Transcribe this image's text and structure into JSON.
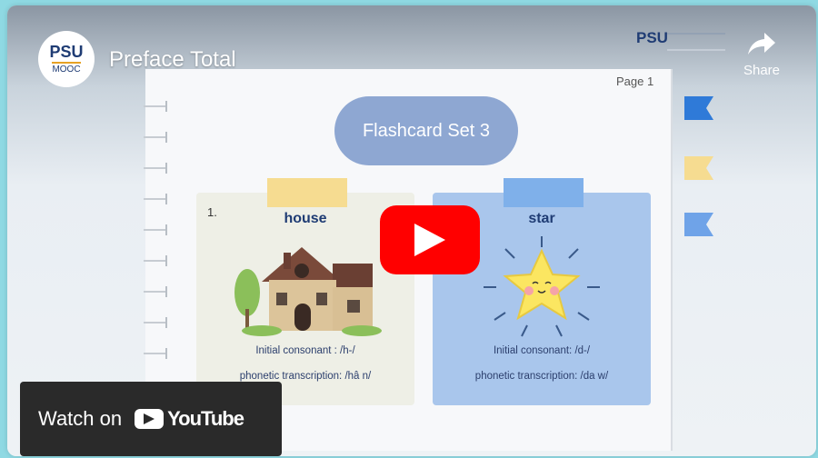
{
  "header": {
    "channel_logo_line1": "PSU",
    "channel_logo_line2": "MOOC",
    "video_title": "Preface Total",
    "corner_logo": "PSU",
    "share_label": "Share",
    "share_icon": "share-arrow-icon"
  },
  "slide": {
    "page_label": "Page 1",
    "title": "Flashcard Set 3",
    "cards": [
      {
        "number": "1.",
        "word": "house",
        "caption_1": "Initial consonant : /h-/",
        "caption_2": "phonetic transcription: /hâ n/",
        "image": "house-illustration"
      },
      {
        "number": "",
        "word": "star",
        "caption_1": "Initial consonant: /d-/",
        "caption_2": "phonetic transcription: /da w/",
        "image": "star-illustration"
      }
    ],
    "flag_colors": [
      "#2f7ad8",
      "#f6dc91",
      "#6fa3e8"
    ]
  },
  "player": {
    "play_icon": "youtube-play-icon",
    "watch_on_label": "Watch on",
    "youtube_label": "YouTube"
  },
  "colors": {
    "youtube_red": "#ff0000",
    "title_pill": "#8ea7d2",
    "house_tape": "#f6dc91",
    "star_card": "#a9c6ec"
  }
}
